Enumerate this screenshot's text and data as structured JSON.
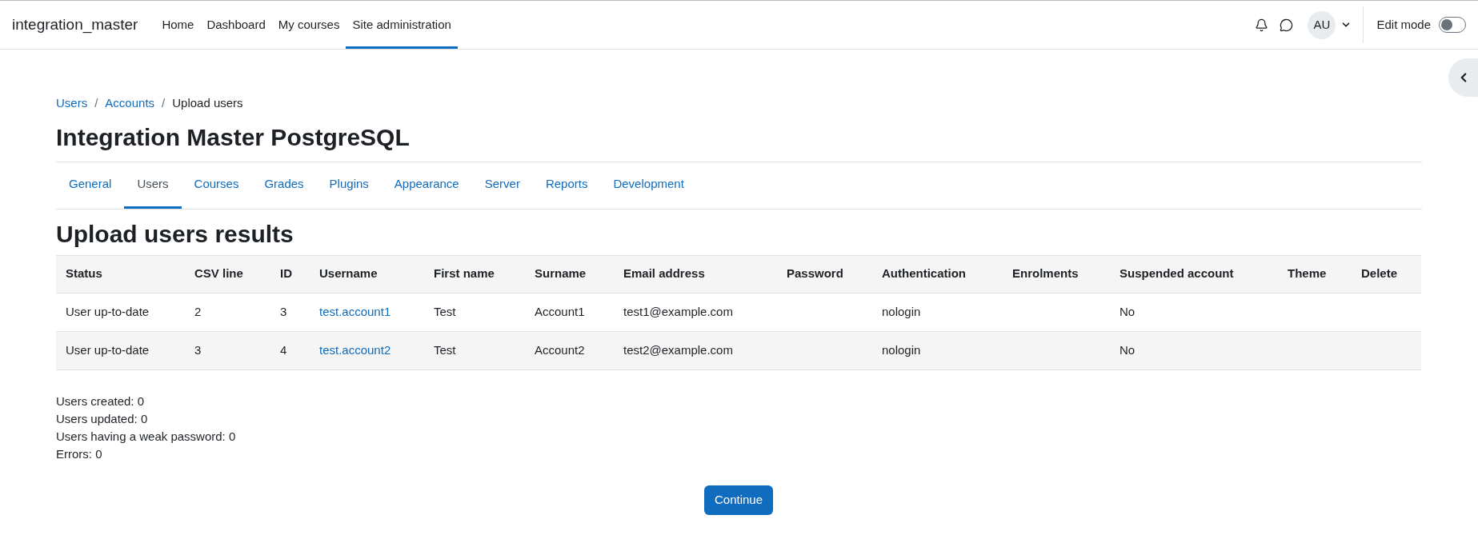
{
  "site_name": "integration_master",
  "nav": [
    {
      "label": "Home",
      "selected": false
    },
    {
      "label": "Dashboard",
      "selected": false
    },
    {
      "label": "My courses",
      "selected": false
    },
    {
      "label": "Site administration",
      "selected": true
    }
  ],
  "user_initials": "AU",
  "edit_mode": {
    "label": "Edit mode",
    "on": false
  },
  "breadcrumb": [
    {
      "label": "Users",
      "kind": "link"
    },
    {
      "label": "/",
      "kind": "separator"
    },
    {
      "label": "Accounts",
      "kind": "link"
    },
    {
      "label": "/",
      "kind": "separator"
    },
    {
      "label": "Upload users",
      "kind": "current"
    }
  ],
  "page_title": "Integration Master PostgreSQL",
  "tabs": [
    {
      "label": "General",
      "selected": false
    },
    {
      "label": "Users",
      "selected": true
    },
    {
      "label": "Courses",
      "selected": false
    },
    {
      "label": "Grades",
      "selected": false
    },
    {
      "label": "Plugins",
      "selected": false
    },
    {
      "label": "Appearance",
      "selected": false
    },
    {
      "label": "Server",
      "selected": false
    },
    {
      "label": "Reports",
      "selected": false
    },
    {
      "label": "Development",
      "selected": false
    }
  ],
  "section_title": "Upload users results",
  "table": {
    "columns": [
      "Status",
      "CSV line",
      "ID",
      "Username",
      "First name",
      "Surname",
      "Email address",
      "Password",
      "Authentication",
      "Enrolments",
      "Suspended account",
      "Theme",
      "Delete"
    ],
    "rows": [
      [
        "User up-to-date",
        "2",
        "3",
        {
          "text": "test.account1",
          "kind": "link"
        },
        "Test",
        "Account1",
        "test1@example.com",
        null,
        "nologin",
        null,
        "No",
        null,
        null
      ],
      [
        "User up-to-date",
        "3",
        "4",
        {
          "text": "test.account2",
          "kind": "link"
        },
        "Test",
        "Account2",
        "test2@example.com",
        null,
        "nologin",
        null,
        "No",
        null,
        null
      ]
    ]
  },
  "summary": [
    "Users created: 0",
    "Users updated: 0",
    "Users having a weak password: 0",
    "Errors: 0"
  ],
  "continue_button": "Continue"
}
